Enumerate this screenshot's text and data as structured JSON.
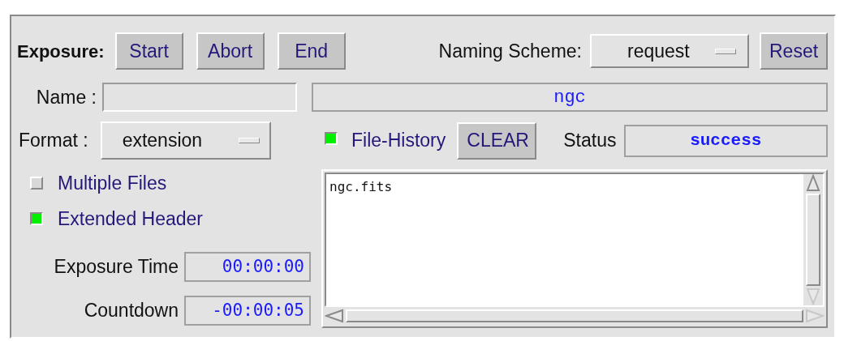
{
  "exposure": {
    "label": "Exposure:",
    "buttons": [
      "Start",
      "Abort",
      "End"
    ]
  },
  "naming_scheme": {
    "label": "Naming Scheme:",
    "value": "request"
  },
  "reset_button": "Reset",
  "name": {
    "label": "Name :"
  },
  "filename_display": "ngc",
  "format": {
    "label": "Format :",
    "value": "extension"
  },
  "file_history": {
    "label": "File-History",
    "checked": true
  },
  "clear_button": "CLEAR",
  "status": {
    "label": "Status",
    "value": "success"
  },
  "options": [
    {
      "label": "Multiple Files",
      "checked": false
    },
    {
      "label": "Extended Header",
      "checked": true
    }
  ],
  "exposure_time": {
    "label": "Exposure Time",
    "value": "00:00:00"
  },
  "countdown": {
    "label": "Countdown",
    "value": "-00:00:05"
  },
  "history_list": [
    "ngc.fits"
  ]
}
